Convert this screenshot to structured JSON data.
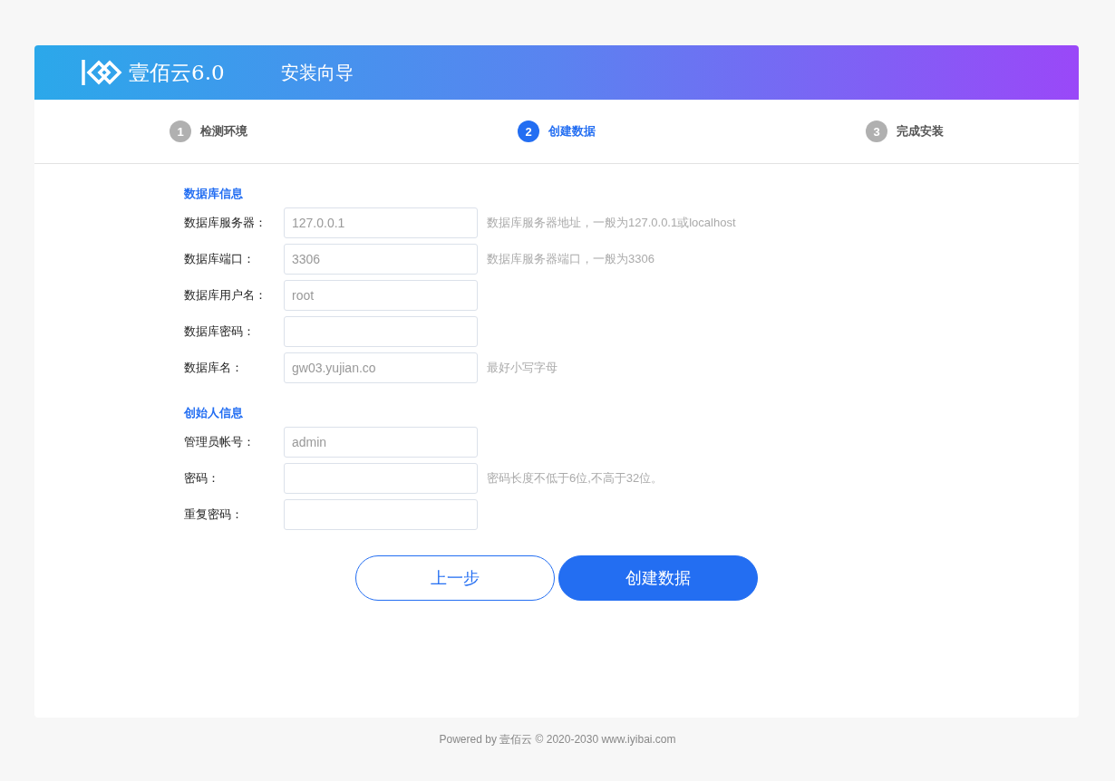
{
  "header": {
    "logo_text": "壹佰云6.0",
    "title": "安装向导"
  },
  "steps": [
    {
      "number": "1",
      "label": "检测环境",
      "selected": false
    },
    {
      "number": "2",
      "label": "创建数据",
      "selected": true
    },
    {
      "number": "3",
      "label": "完成安装",
      "selected": false
    }
  ],
  "sections": [
    {
      "title": "数据库信息",
      "fields": [
        {
          "label": "数据库服务器：",
          "value": "127.0.0.1",
          "hint": "数据库服务器地址，一般为127.0.0.1或localhost"
        },
        {
          "label": "数据库端口：",
          "value": "3306",
          "hint": "数据库服务器端口，一般为3306"
        },
        {
          "label": "数据库用户名：",
          "value": "root"
        },
        {
          "label": "数据库密码："
        },
        {
          "label": "数据库名：",
          "value": "gw03.yujian.co",
          "hint": "最好小写字母"
        }
      ]
    },
    {
      "title": "创始人信息",
      "fields": [
        {
          "label": "管理员帐号：",
          "value": "admin"
        },
        {
          "label": "密码：",
          "hint": "密码长度不低于6位,不高于32位。"
        },
        {
          "label": "重复密码："
        }
      ]
    }
  ],
  "buttons": [
    {
      "kind": "secondary",
      "label": "上一步"
    },
    {
      "kind": "primary",
      "label": "创建数据"
    }
  ],
  "footer": "Powered by 壹佰云 © 2020-2030 www.iyibai.com"
}
